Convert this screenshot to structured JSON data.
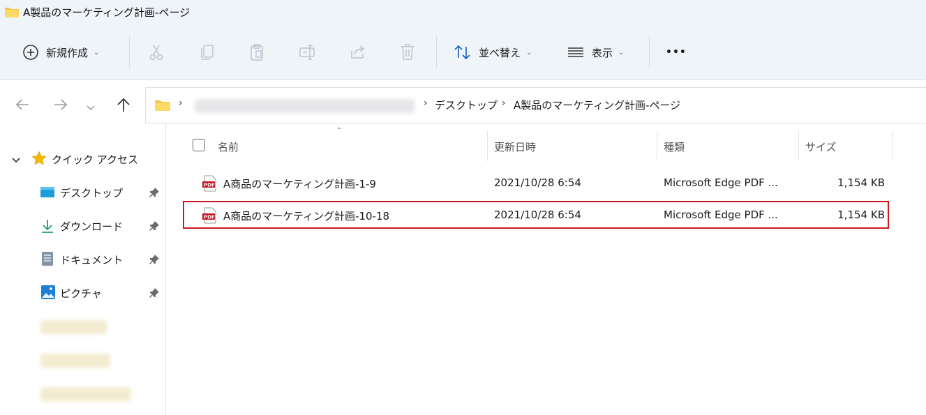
{
  "window": {
    "title": "A製品のマーケティング計画-ページ"
  },
  "toolbar": {
    "new_label": "新規作成",
    "sort_label": "並べ替え",
    "view_label": "表示",
    "more_label": "•••"
  },
  "address": {
    "crumbs": [
      "デスクトップ",
      "A製品のマーケティング計画-ページ"
    ]
  },
  "sidebar": {
    "quick_access": "クイック アクセス",
    "items": [
      {
        "label": "デスクトップ",
        "icon": "desktop-icon"
      },
      {
        "label": "ダウンロード",
        "icon": "download-icon"
      },
      {
        "label": "ドキュメント",
        "icon": "document-icon"
      },
      {
        "label": "ピクチャ",
        "icon": "picture-icon"
      }
    ]
  },
  "columns": {
    "name": "名前",
    "modified": "更新日時",
    "type": "種類",
    "size": "サイズ"
  },
  "files": [
    {
      "name": "A商品のマーケティング計画-1-9",
      "modified": "2021/10/28 6:54",
      "type": "Microsoft Edge PDF ...",
      "size": "1,154 KB",
      "selected": false
    },
    {
      "name": "A商品のマーケティング計画-10-18",
      "modified": "2021/10/28 6:54",
      "type": "Microsoft Edge PDF ...",
      "size": "1,154 KB",
      "selected": true
    }
  ],
  "colors": {
    "selection_outline": "#d0161c",
    "chrome_bg": "#eff4f9"
  }
}
